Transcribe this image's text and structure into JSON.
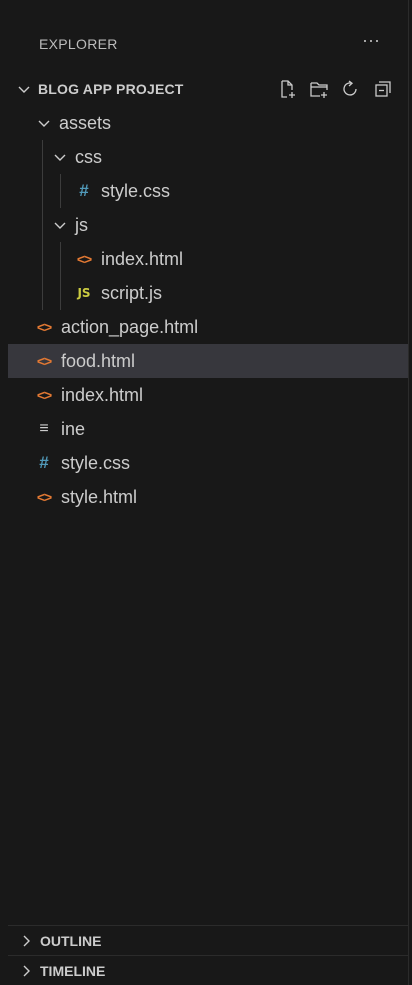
{
  "explorer": {
    "title": "EXPLORER",
    "more_label": "···"
  },
  "project": {
    "name": "BLOG APP PROJECT",
    "actions": [
      "new-file",
      "new-folder",
      "refresh",
      "collapse-all"
    ]
  },
  "tree": {
    "assets": "assets",
    "css_folder": "css",
    "css_style": "style.css",
    "js_folder": "js",
    "js_index": "index.html",
    "js_script": "script.js",
    "action_page": "action_page.html",
    "food": "food.html",
    "index": "index.html",
    "ine": "ine",
    "style_css": "style.css",
    "style_html": "style.html"
  },
  "icons": {
    "html_glyph": "<>",
    "css_glyph": "#",
    "js_glyph": "JS",
    "text_glyph": "≡"
  },
  "selected_item": "food.html",
  "sections": {
    "outline": "OUTLINE",
    "timeline": "TIMELINE"
  },
  "colors": {
    "background": "#181818",
    "selected": "#37373d",
    "html_icon": "#e37933",
    "css_icon": "#519aba",
    "js_icon": "#cbcb41"
  }
}
